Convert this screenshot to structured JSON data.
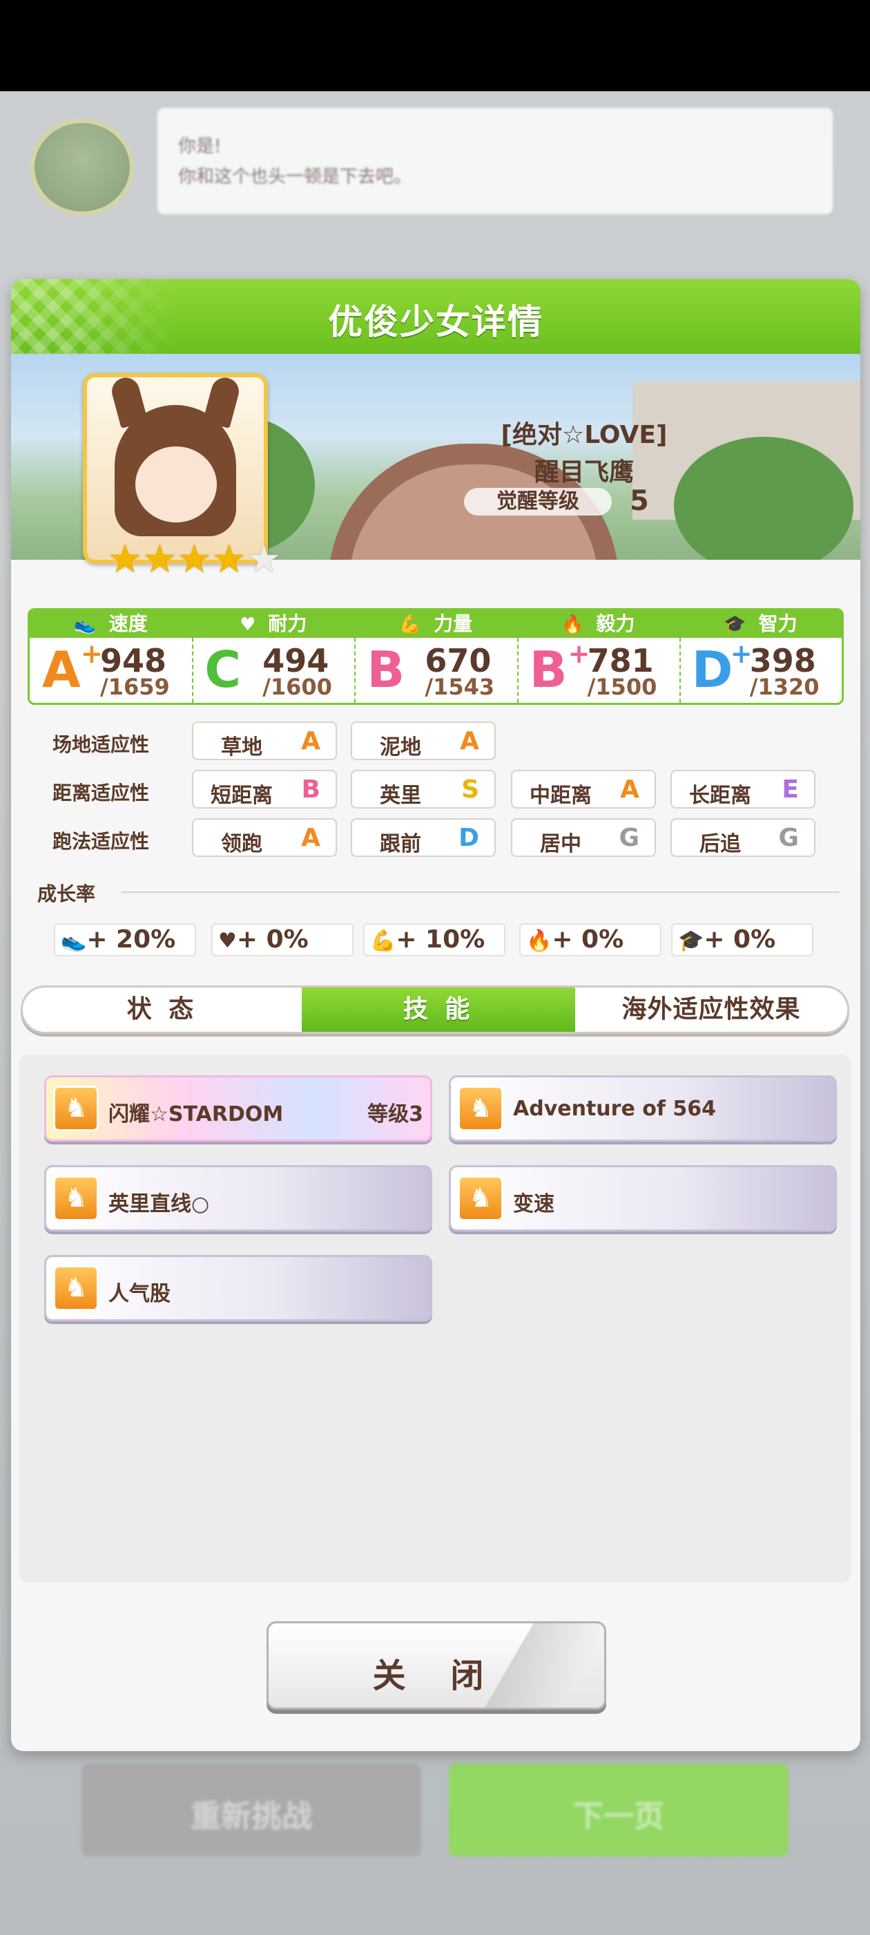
{
  "background": {
    "dialog_lines": [
      "你是!",
      "你和这个也头一顿是下去吧。"
    ],
    "bottom_left_label": "重新挑战",
    "bottom_right_label": "下一页"
  },
  "panel": {
    "title": "优俊少女详情"
  },
  "character": {
    "title": "[绝对☆LOVE]",
    "name": "醒目飞鹰",
    "awaken_label": "觉醒等级",
    "awaken_level": "5",
    "stars_filled": 4,
    "stars_total": 5
  },
  "stats": [
    {
      "label": "速度",
      "icon": "shoe-icon",
      "glyph": "👟",
      "grade": "A",
      "plus": "+",
      "value": "948",
      "max": "/1659",
      "color": "#f08a1c"
    },
    {
      "label": "耐力",
      "icon": "heart-icon",
      "glyph": "♥",
      "grade": "C",
      "plus": "",
      "value": "494",
      "max": "/1600",
      "color": "#4fbf3a"
    },
    {
      "label": "力量",
      "icon": "muscle-icon",
      "glyph": "💪",
      "grade": "B",
      "plus": "",
      "value": "670",
      "max": "/1543",
      "color": "#ee5f96"
    },
    {
      "label": "毅力",
      "icon": "flame-icon",
      "glyph": "🔥",
      "grade": "B",
      "plus": "+",
      "value": "781",
      "max": "/1500",
      "color": "#ee5f96"
    },
    {
      "label": "智力",
      "icon": "graduation-cap-icon",
      "glyph": "🎓",
      "grade": "D",
      "plus": "+",
      "value": "398",
      "max": "/1320",
      "color": "#3a9ee6"
    }
  ],
  "aptitudes": {
    "track": {
      "label": "场地适应性",
      "items": [
        {
          "name": "草地",
          "grade": "A"
        },
        {
          "name": "泥地",
          "grade": "A"
        }
      ]
    },
    "distance": {
      "label": "距离适应性",
      "items": [
        {
          "name": "短距离",
          "grade": "B"
        },
        {
          "name": "英里",
          "grade": "S"
        },
        {
          "name": "中距离",
          "grade": "A"
        },
        {
          "name": "长距离",
          "grade": "E"
        }
      ]
    },
    "strategy": {
      "label": "跑法适应性",
      "items": [
        {
          "name": "领跑",
          "grade": "A"
        },
        {
          "name": "跟前",
          "grade": "D"
        },
        {
          "name": "居中",
          "grade": "G"
        },
        {
          "name": "后追",
          "grade": "G"
        }
      ]
    },
    "grade_colors": {
      "S": "#e9b500",
      "A": "#f08a1c",
      "B": "#ee5f96",
      "C": "#4fbf3a",
      "D": "#3a9ee6",
      "E": "#b06ee0",
      "G": "#9a9a9a"
    }
  },
  "growth": {
    "label": "成长率",
    "items": [
      {
        "icon": "shoe-icon",
        "glyph": "👟",
        "text": "+ 20%"
      },
      {
        "icon": "heart-icon",
        "glyph": "♥",
        "text": "+ 0%"
      },
      {
        "icon": "muscle-icon",
        "glyph": "💪",
        "text": "+ 10%"
      },
      {
        "icon": "flame-icon",
        "glyph": "🔥",
        "text": "+ 0%"
      },
      {
        "icon": "graduation-cap-icon",
        "glyph": "🎓",
        "text": "+ 0%"
      }
    ]
  },
  "tabs": [
    {
      "label": "状 态",
      "active": false
    },
    {
      "label": "技 能",
      "active": true
    },
    {
      "label": "海外适应性效果",
      "active": false
    }
  ],
  "skills": [
    {
      "name": "闪耀☆STARDOM",
      "level": "等级3",
      "rainbow": true
    },
    {
      "name": "Adventure of 564",
      "level": "",
      "rainbow": false
    },
    {
      "name": "英里直线○",
      "level": "",
      "rainbow": false
    },
    {
      "name": "变速",
      "level": "",
      "rainbow": false
    },
    {
      "name": "人气股",
      "level": "",
      "rainbow": false
    }
  ],
  "close_button": {
    "label": "关 闭"
  }
}
